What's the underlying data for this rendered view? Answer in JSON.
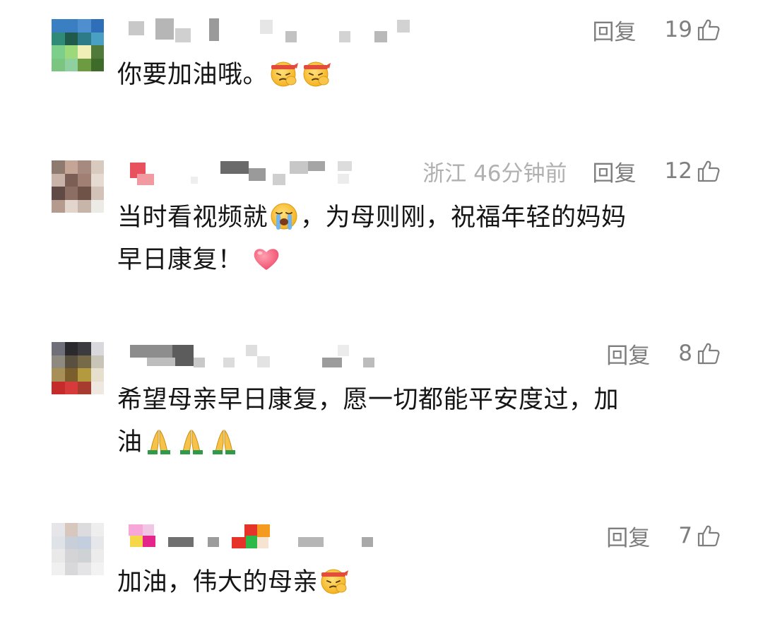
{
  "comments": [
    {
      "location_time": "",
      "reply_label": "回复",
      "likes": "19",
      "text": "你要加油哦。",
      "emojis_after": [
        "fighting-emoji",
        "fighting-emoji"
      ],
      "avatar_colors": [
        "#3a7fc1",
        "#3a7fc1",
        "#4f8fd0",
        "#2f6eb8",
        "#2f8a77",
        "#1f5a4a",
        "#2d7a88",
        "#4aa0c4",
        "#7ccf8a",
        "#9bd97a",
        "#f0efb8",
        "#4f7a3a",
        "#7ac57f",
        "#8fd0a0",
        "#6d9b41",
        "#3e6b2a"
      ]
    },
    {
      "location_time": "浙江 46分钟前",
      "reply_label": "回复",
      "likes": "12",
      "text_lines": [
        "当时看视频就",
        "，为母则刚，祝福年轻的妈妈",
        "早日康复！"
      ],
      "emojis": [
        "crying-emoji",
        "heart-emoji"
      ],
      "avatar_colors": [
        "#8f7a70",
        "#c4a596",
        "#a68a80",
        "#d8cabf",
        "#c9b3a8",
        "#7b5e56",
        "#a17f73",
        "#e6dbd1",
        "#5f4a45",
        "#8c6e65",
        "#6f5349",
        "#d2c2b8",
        "#b59a8e",
        "#e2d6cc",
        "#c8b5aa",
        "#ecebe6"
      ]
    },
    {
      "location_time": "",
      "reply_label": "回复",
      "likes": "8",
      "text_lines": [
        "希望母亲早日康复，愿一切都能平安度过，加",
        "油"
      ],
      "emojis_after": [
        "pray-emoji",
        "pray-emoji",
        "pray-emoji"
      ],
      "avatar_colors": [
        "#6f6f7a",
        "#2a2a2e",
        "#3b3b40",
        "#d9d9dd",
        "#8f8a80",
        "#595040",
        "#776a48",
        "#c9c4b8",
        "#a88f58",
        "#7a5f2c",
        "#b39a3e",
        "#e6dfcd",
        "#c62b2b",
        "#d63a3a",
        "#a83b2f",
        "#efe8e0"
      ]
    },
    {
      "location_time": "",
      "reply_label": "回复",
      "likes": "7",
      "text": "加油，伟大的母亲",
      "emojis_after": [
        "fighting-emoji"
      ],
      "avatar_colors": [
        "#e6e6ea",
        "#d8c7bd",
        "#dcdcdf",
        "#eeeeef",
        "#dfe3e8",
        "#c8cfd8",
        "#c3cede",
        "#e5e7ea",
        "#e9e9ea",
        "#d4d4d6",
        "#cfd2d5",
        "#ececec",
        "#f0f0f0",
        "#d8d8da",
        "#e4e4e6",
        "#f2f2f2"
      ]
    }
  ],
  "ui": {
    "text_color": "#151515",
    "meta_color": "#8e8e8e",
    "location_color": "#b0b0b0"
  }
}
